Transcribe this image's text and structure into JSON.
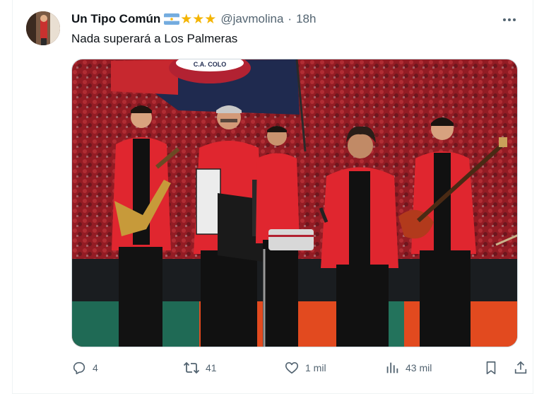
{
  "tweet": {
    "display_name": "Un Tipo Común",
    "badges": {
      "flag": "argentina-flag-icon",
      "stars": "★★★"
    },
    "handle": "@javmolina",
    "separator": "·",
    "time": "18h",
    "text": "Nada superará a Los Palmeras",
    "media_alt_icon": "photo-band-on-stage",
    "flag_text": "C.A. COLO"
  },
  "actions": {
    "replies": "4",
    "retweets": "41",
    "likes": "1 mil",
    "views": "43 mil"
  },
  "colors": {
    "accent_star": "#f4b400",
    "secondary_text": "#536471",
    "primary_text": "#0f1419",
    "jacket_red": "#e0262f",
    "crowd_red": "#b8252e"
  }
}
